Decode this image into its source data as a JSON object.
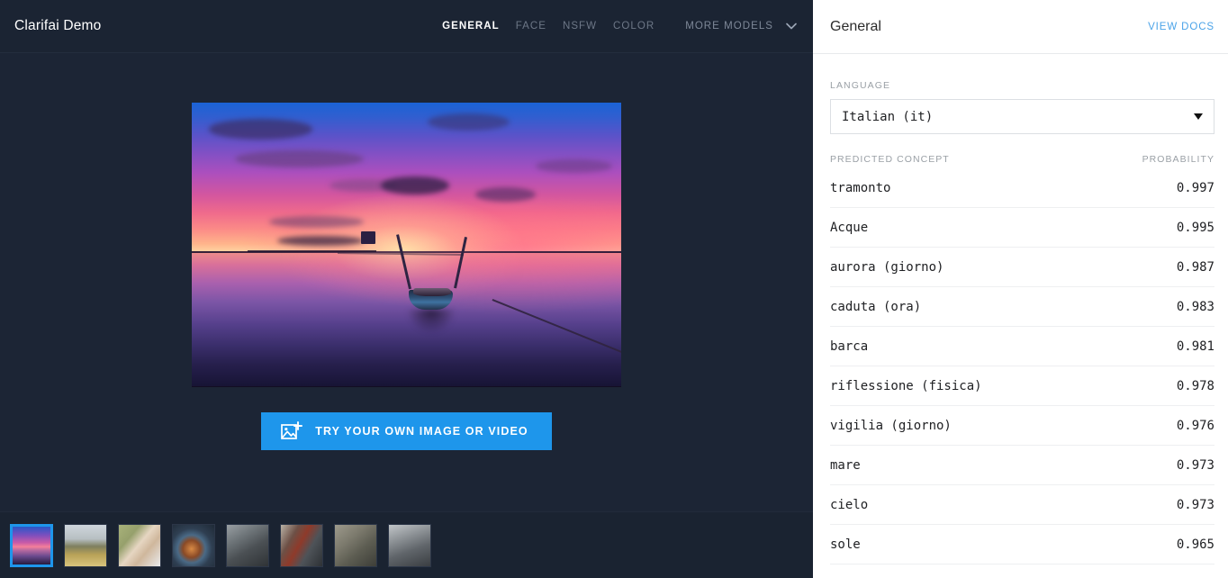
{
  "navbar": {
    "brand": "Clarifai Demo",
    "tabs": [
      {
        "label": "GENERAL",
        "active": true
      },
      {
        "label": "FACE",
        "active": false
      },
      {
        "label": "NSFW",
        "active": false
      },
      {
        "label": "COLOR",
        "active": false
      }
    ],
    "more_models_label": "MORE MODELS",
    "chevron_icon": "chevron-down-icon"
  },
  "stage": {
    "main_image_alt": "sunset over calm water with moored wooden boat",
    "cta": {
      "label": "TRY YOUR OWN IMAGE OR VIDEO",
      "icon": "add-image-icon",
      "color": "#1e96eb"
    }
  },
  "thumbnails": [
    {
      "name": "thumbnail-sunset-boat",
      "selected": true
    },
    {
      "name": "thumbnail-savanna-field",
      "selected": false
    },
    {
      "name": "thumbnail-portrait-woman",
      "selected": false
    },
    {
      "name": "thumbnail-food-plate",
      "selected": false
    },
    {
      "name": "thumbnail-crowd-grayscale",
      "selected": false
    },
    {
      "name": "thumbnail-street-scene",
      "selected": false
    },
    {
      "name": "thumbnail-aerial-landscape",
      "selected": false
    },
    {
      "name": "thumbnail-cityscape",
      "selected": false
    }
  ],
  "results": {
    "title": "General",
    "view_docs_label": "VIEW DOCS",
    "language_label": "LANGUAGE",
    "language_value": "Italian (it)",
    "columns": {
      "concept": "PREDICTED CONCEPT",
      "probability": "PROBABILITY"
    },
    "concepts": [
      {
        "name": "tramonto",
        "probability": "0.997"
      },
      {
        "name": "Acque",
        "probability": "0.995"
      },
      {
        "name": "aurora (giorno)",
        "probability": "0.987"
      },
      {
        "name": "caduta (ora)",
        "probability": "0.983"
      },
      {
        "name": "barca",
        "probability": "0.981"
      },
      {
        "name": "riflessione (fisica)",
        "probability": "0.978"
      },
      {
        "name": "vigilia (giorno)",
        "probability": "0.976"
      },
      {
        "name": "mare",
        "probability": "0.973"
      },
      {
        "name": "cielo",
        "probability": "0.973"
      },
      {
        "name": "sole",
        "probability": "0.965"
      }
    ]
  },
  "colors": {
    "app_background": "#1c2535",
    "navbar_background": "#1b2433",
    "accent_blue": "#1e96eb",
    "link_blue": "#4aa3e8",
    "panel_background": "#ffffff"
  }
}
